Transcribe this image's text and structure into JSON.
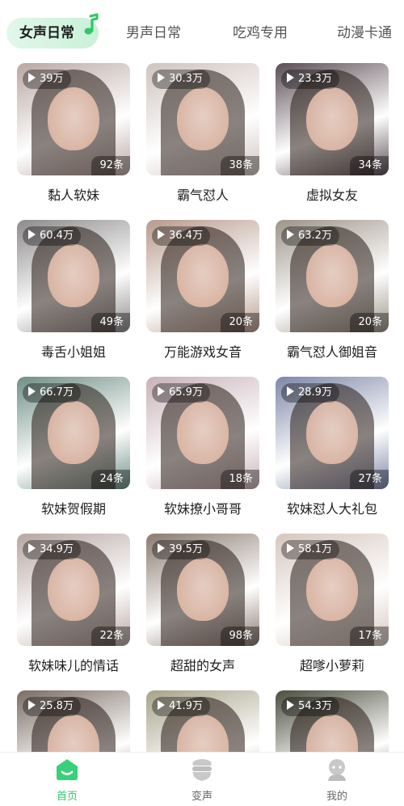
{
  "tabs": [
    {
      "label": "女声日常",
      "active": true
    },
    {
      "label": "男声日常",
      "active": false
    },
    {
      "label": "吃鸡专用",
      "active": false
    },
    {
      "label": "动漫卡通",
      "active": false
    }
  ],
  "colors": {
    "accent": "#2fc86a",
    "tab_active_bg": "#c9f1d8"
  },
  "cards": [
    {
      "plays": "39万",
      "count": "92条",
      "title": "黏人软妹",
      "bg": "#b9a7a3"
    },
    {
      "plays": "30.3万",
      "count": "38条",
      "title": "霸气怼人",
      "bg": "#cfc3bf"
    },
    {
      "plays": "23.3万",
      "count": "34条",
      "title": "虚拟女友",
      "bg": "#5b4d55"
    },
    {
      "plays": "60.4万",
      "count": "49条",
      "title": "毒舌小姐姐",
      "bg": "#8d8a8a"
    },
    {
      "plays": "36.4万",
      "count": "20条",
      "title": "万能游戏女音",
      "bg": "#b79a8c"
    },
    {
      "plays": "63.2万",
      "count": "20条",
      "title": "霸气怼人御姐音",
      "bg": "#9c9488"
    },
    {
      "plays": "66.7万",
      "count": "24条",
      "title": "软妹贺假期",
      "bg": "#6f8f86"
    },
    {
      "plays": "65.9万",
      "count": "18条",
      "title": "软妹撩小哥哥",
      "bg": "#c8b2b8"
    },
    {
      "plays": "28.9万",
      "count": "27条",
      "title": "软妹怼人大礼包",
      "bg": "#7d87a8"
    },
    {
      "plays": "34.9万",
      "count": "22条",
      "title": "软妹味儿的情话",
      "bg": "#b7a6a2"
    },
    {
      "plays": "39.5万",
      "count": "98条",
      "title": "超甜的女声",
      "bg": "#8a7a70"
    },
    {
      "plays": "58.1万",
      "count": "17条",
      "title": "超嗲小萝莉",
      "bg": "#d6c7bf"
    },
    {
      "plays": "25.8万",
      "count": "",
      "title": "",
      "bg": "#7a6c64"
    },
    {
      "plays": "41.9万",
      "count": "",
      "title": "",
      "bg": "#a7a38a"
    },
    {
      "plays": "54.3万",
      "count": "",
      "title": "",
      "bg": "#4a4e3e"
    }
  ],
  "nav": {
    "home": {
      "label": "首页",
      "icon": "home-icon",
      "active": true
    },
    "voice": {
      "label": "变声",
      "icon": "voice-change-icon",
      "active": false
    },
    "me": {
      "label": "我的",
      "icon": "profile-icon",
      "active": false
    }
  }
}
